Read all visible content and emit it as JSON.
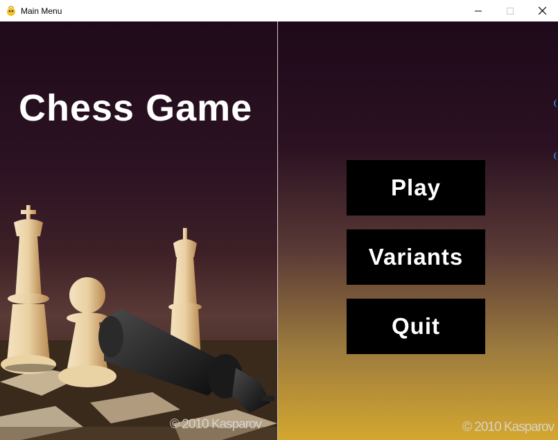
{
  "window": {
    "title": "Main Menu",
    "controls": {
      "minimize": "—",
      "maximize": "☐",
      "close": "✕"
    }
  },
  "left_panel": {
    "title": "Chess Game",
    "copyright": "© 2010 Kasparov"
  },
  "right_panel": {
    "copyright": "© 2010 Kasparov"
  },
  "menu": {
    "buttons": [
      {
        "label": "Play"
      },
      {
        "label": "Variants"
      },
      {
        "label": "Quit"
      }
    ]
  },
  "colors": {
    "button_bg": "#000000",
    "button_text": "#ffffff",
    "title_text": "#ffffff"
  },
  "icons": {
    "app": "pygame-snake-icon",
    "minimize": "minimize-icon",
    "maximize": "maximize-icon",
    "close": "close-icon"
  }
}
